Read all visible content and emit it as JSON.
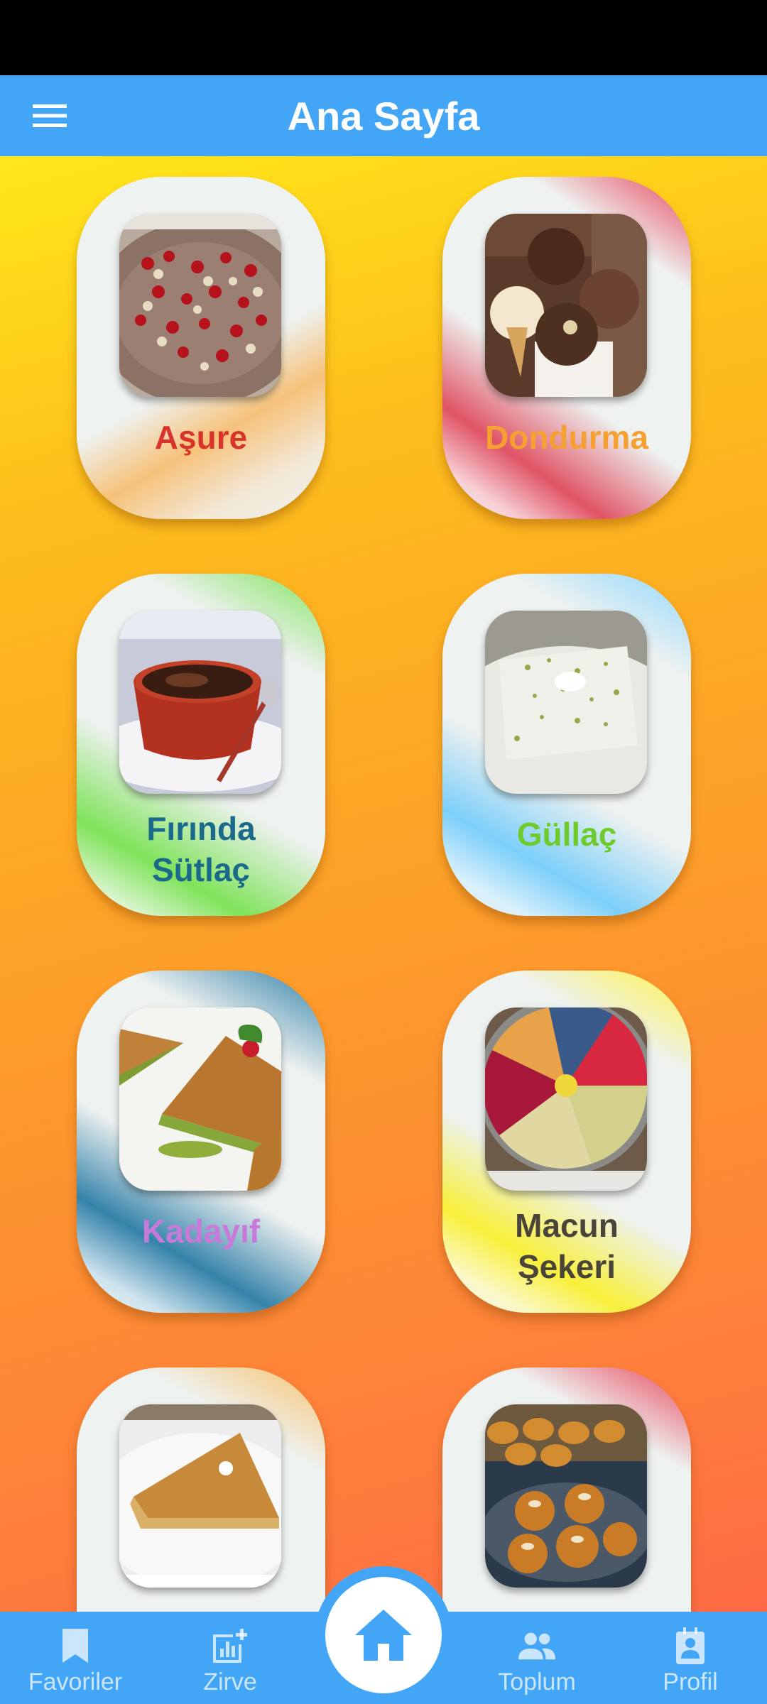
{
  "app_bar": {
    "title": "Ana Sayfa",
    "menu_icon": "menu-icon"
  },
  "desserts": [
    {
      "name": "Aşure",
      "color": "#d9342b"
    },
    {
      "name": "Dondurma",
      "color": "#f5a031"
    },
    {
      "name": "Fırında Sütlaç",
      "line1": "Fırında",
      "line2": "Sütlaç",
      "color": "#1b6a8c"
    },
    {
      "name": "Güllaç",
      "color": "#6ecb2b"
    },
    {
      "name": "Kadayıf",
      "color": "#c77ad9"
    },
    {
      "name": "Macun Şekeri",
      "line1": "Macun",
      "line2": "Şekeri",
      "color": "#4a4538"
    }
  ],
  "bottom_nav": {
    "favoriler": "Favoriler",
    "zirve": "Zirve",
    "toplum": "Toplum",
    "profil": "Profil",
    "home_icon": "home-icon"
  },
  "colors": {
    "primary": "#42a5f5",
    "background_top": "#ffe81a",
    "background_bottom": "#ff6a45"
  }
}
